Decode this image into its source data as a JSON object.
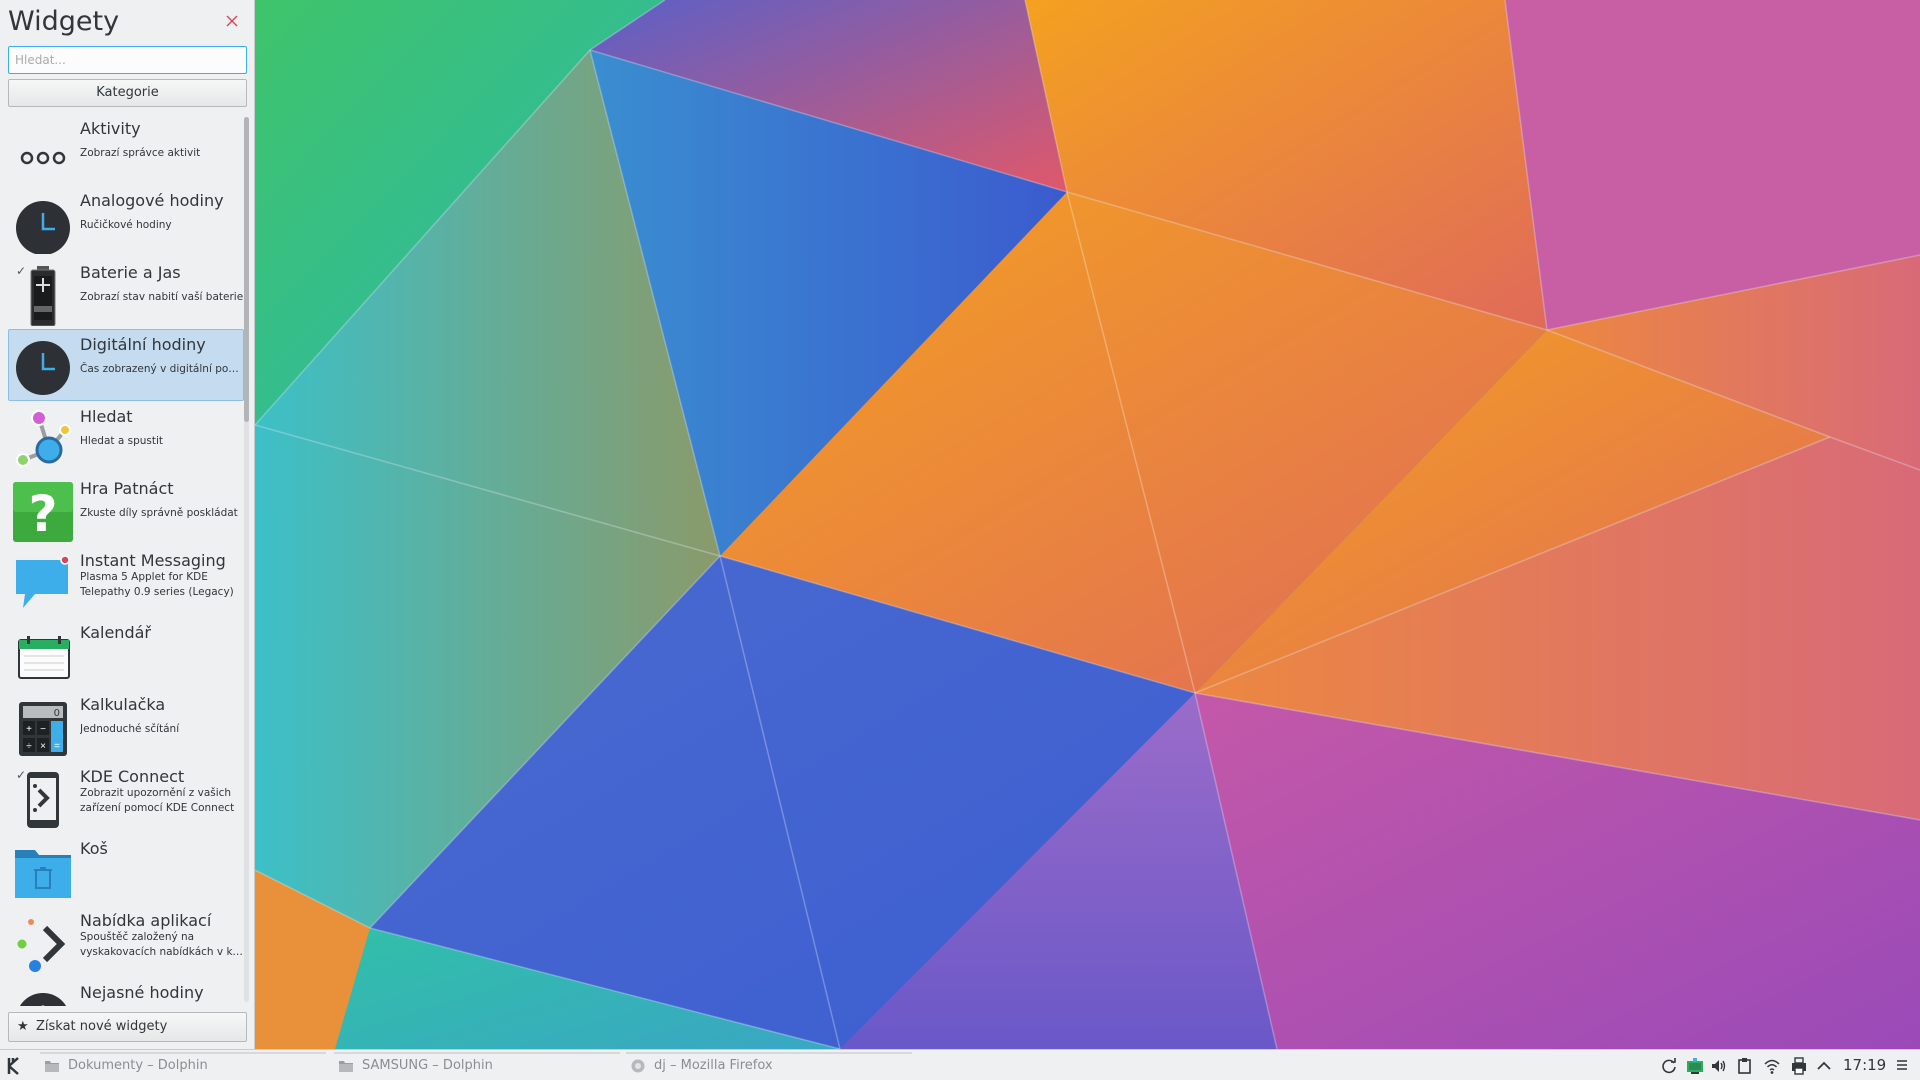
{
  "sidebar": {
    "title": "Widgety",
    "search_placeholder": "Hledat...",
    "category_button": "Kategorie",
    "get_new": "Získat nové widgety",
    "items": [
      {
        "name": "Aktivity",
        "desc": "Zobrazí správce aktivit",
        "icon": "activities-icon",
        "installed": false
      },
      {
        "name": "Analogové hodiny",
        "desc": "Ručičkové hodiny",
        "icon": "analog-clock-icon",
        "installed": false
      },
      {
        "name": "Baterie a Jas",
        "desc": "Zobrazí stav nabití vaší baterie",
        "icon": "battery-icon",
        "installed": true
      },
      {
        "name": "Digitální hodiny",
        "desc": "Čas zobrazený v digitální podobě",
        "icon": "digital-clock-icon",
        "installed": true,
        "selected": true
      },
      {
        "name": "Hledat",
        "desc": "Hledat a spustit",
        "icon": "search-molecule-icon",
        "installed": false
      },
      {
        "name": "Hra Patnáct",
        "desc": "Zkuste díly správně poskládat",
        "icon": "question-mark-icon",
        "installed": false
      },
      {
        "name": "Instant Messaging",
        "desc_lines": [
          "Plasma 5 Applet for KDE",
          "Telepathy 0.9 series (Legacy)"
        ],
        "icon": "chat-bubble-icon",
        "installed": false
      },
      {
        "name": "Kalendář",
        "desc": "",
        "icon": "calendar-icon",
        "installed": false
      },
      {
        "name": "Kalkulačka",
        "desc": "Jednoduché sčítání",
        "icon": "calculator-icon",
        "installed": false
      },
      {
        "name": "KDE Connect",
        "desc_lines": [
          "Zobrazit upozornění z vašich",
          "zařízení pomocí KDE Connect"
        ],
        "icon": "kde-connect-icon",
        "installed": true
      },
      {
        "name": "Koš",
        "desc": "",
        "icon": "trash-folder-icon",
        "installed": false
      },
      {
        "name": "Nabídka aplikací",
        "desc_lines": [
          "Spouštěč založený na",
          "vyskakovacích nabídkách v kas..."
        ],
        "icon": "app-menu-icon",
        "installed": false
      },
      {
        "name": "Nejasné hodiny",
        "desc": "",
        "icon": "fuzzy-clock-icon",
        "installed": false
      }
    ],
    "scroll_fraction": 0.34
  },
  "panel": {
    "tasks": [
      {
        "label": "Dokumenty – Dolphin",
        "icon": "dolphin-icon"
      },
      {
        "label": "SAMSUNG – Dolphin",
        "icon": "dolphin-icon"
      },
      {
        "label": "dj – Mozilla Firefox",
        "icon": "firefox-icon"
      }
    ],
    "tray": [
      "sync-icon",
      "network-manager-icon",
      "volume-icon",
      "clipboard-icon",
      "wifi-icon",
      "printer-icon",
      "expand-arrow-icon"
    ],
    "clock": "17:19"
  },
  "colors": {
    "accent": "#3daee9",
    "selection": "#c5dcf0",
    "panel_bg": "#eff0f1",
    "text": "#31363b"
  }
}
